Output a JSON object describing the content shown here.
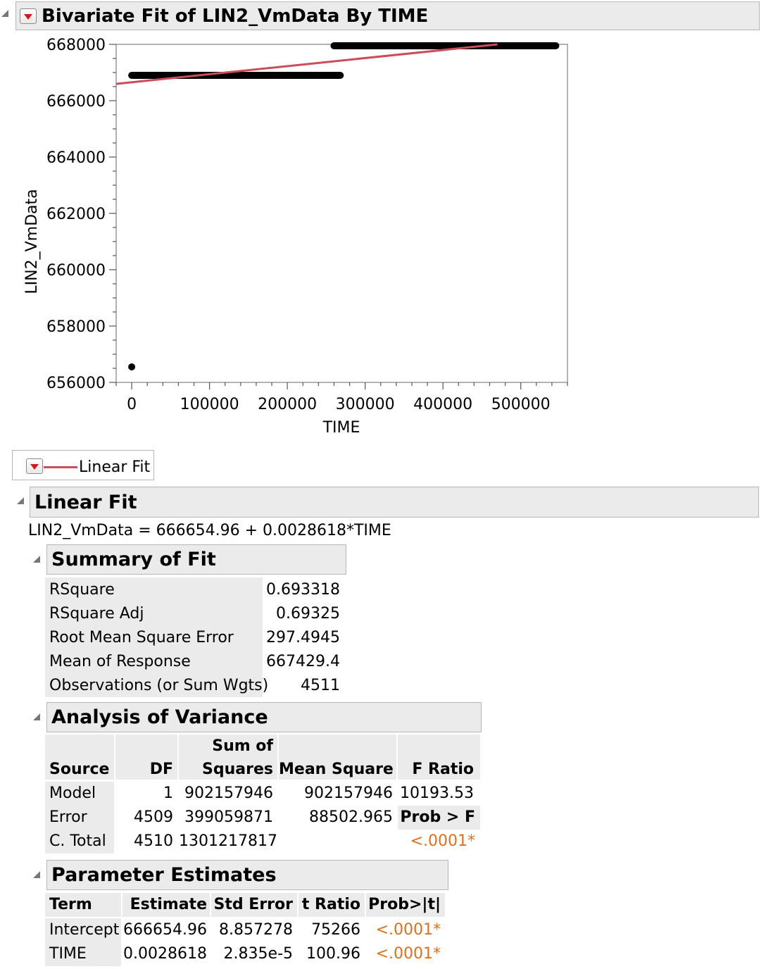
{
  "report": {
    "title": "Bivariate Fit of LIN2_VmData By TIME",
    "linear_fit_legend": "Linear Fit"
  },
  "chart_data": {
    "type": "scatter",
    "xlabel": "TIME",
    "ylabel": "LIN2_VmData",
    "xlim": [
      -20000,
      560000
    ],
    "ylim": [
      656000,
      668000
    ],
    "x_ticks": [
      0,
      100000,
      200000,
      300000,
      400000,
      500000
    ],
    "x_tick_labels": [
      "0",
      "100000",
      "200000",
      "300000",
      "400000",
      "500000"
    ],
    "y_ticks": [
      656000,
      658000,
      660000,
      662000,
      664000,
      666000,
      668000
    ],
    "y_tick_labels": [
      "656000",
      "658000",
      "660000",
      "662000",
      "664000",
      "666000",
      "668000"
    ],
    "grid": false,
    "series": [
      {
        "segment": [
          [
            0,
            666900
          ],
          [
            268000,
            666900
          ]
        ]
      },
      {
        "segment": [
          [
            260000,
            667950
          ],
          [
            545000,
            667950
          ]
        ]
      },
      {
        "points": [
          [
            0,
            656550
          ]
        ]
      }
    ],
    "fit_line": {
      "intercept": 666654.96,
      "slope": 0.0028618,
      "color": "#cc4c5a"
    }
  },
  "linear_fit": {
    "header": "Linear Fit",
    "equation": "LIN2_VmData = 666654.96 + 0.0028618*TIME"
  },
  "summary_of_fit": {
    "header": "Summary of Fit",
    "rows": [
      {
        "label": "RSquare",
        "value": "0.693318"
      },
      {
        "label": "RSquare Adj",
        "value": "0.69325"
      },
      {
        "label": "Root Mean Square Error",
        "value": "297.4945"
      },
      {
        "label": "Mean of Response",
        "value": "667429.4"
      },
      {
        "label": "Observations (or Sum Wgts)",
        "value": "4511"
      }
    ]
  },
  "anova": {
    "header": "Analysis of Variance",
    "col_source": "Source",
    "col_df": "DF",
    "col_ss_line1": "Sum of",
    "col_ss_line2": "Squares",
    "col_ms": "Mean Square",
    "col_f": "F Ratio",
    "model": {
      "source": "Model",
      "df": "1",
      "ss": "902157946",
      "ms": "902157946",
      "f": "10193.53"
    },
    "error": {
      "source": "Error",
      "df": "4509",
      "ss": "399059871",
      "ms": "88502.965",
      "prob_label": "Prob > F"
    },
    "ctotal": {
      "source": "C. Total",
      "df": "4510",
      "ss": "1301217817",
      "prob": "<.0001*"
    }
  },
  "parameter_estimates": {
    "header": "Parameter Estimates",
    "columns": [
      "Term",
      "Estimate",
      "Std Error",
      "t Ratio",
      "Prob>|t|"
    ],
    "rows": [
      {
        "term": "Intercept",
        "estimate": "666654.96",
        "std_error": "8.857278",
        "t_ratio": "75266",
        "prob": "<.0001*"
      },
      {
        "term": "TIME",
        "estimate": "0.0028618",
        "std_error": "2.835e-5",
        "t_ratio": "100.96",
        "prob": "<.0001*"
      }
    ]
  }
}
